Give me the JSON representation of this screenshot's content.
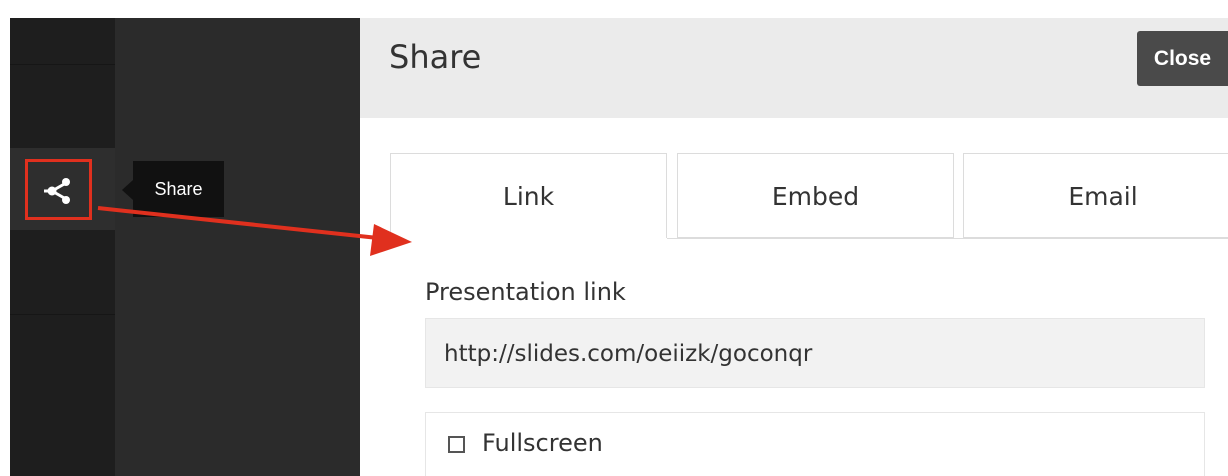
{
  "tooltip": {
    "text": "Share"
  },
  "modal": {
    "title": "Share",
    "close_label": "Close",
    "tabs": [
      {
        "label": "Link",
        "active": true
      },
      {
        "label": "Embed",
        "active": false
      },
      {
        "label": "Email",
        "active": false
      }
    ],
    "link": {
      "label": "Presentation link",
      "value": "http://slides.com/oeiizk/goconqr"
    },
    "fullscreen": {
      "label": "Fullscreen",
      "checked": false
    }
  },
  "colors": {
    "annotation": "#e0301e",
    "close_button": "#4a4a4a",
    "sidebar": "#1e1e1e"
  },
  "icons": {
    "share": "share-icon"
  }
}
